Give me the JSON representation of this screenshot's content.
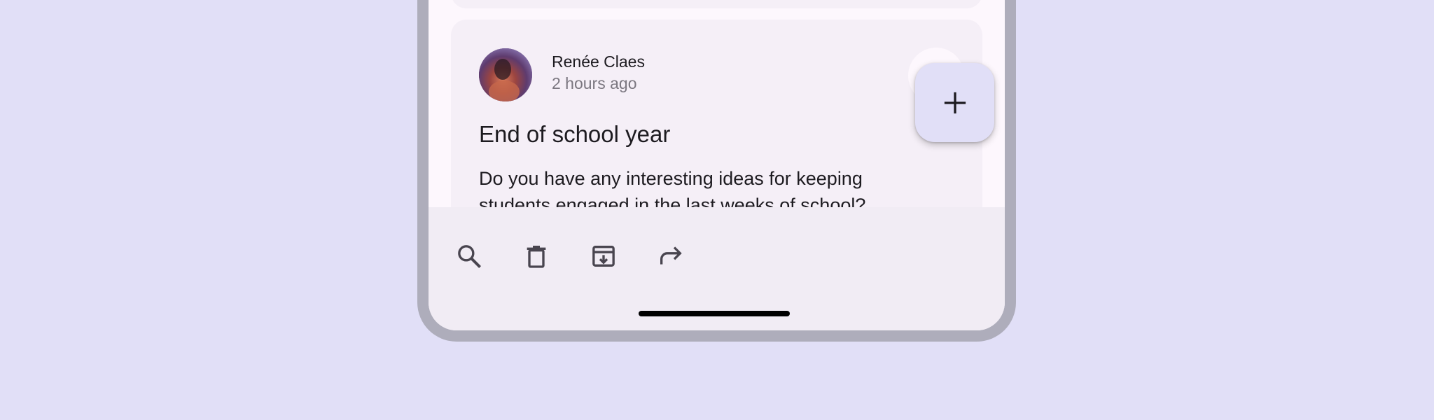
{
  "email": {
    "sender_name": "Renée Claes",
    "timestamp": "2 hours ago",
    "title": "End of school year",
    "body": "Do you have any interesting ideas for keeping students engaged in the last weeks of school?"
  },
  "icons": {
    "star": "star-outline-icon",
    "fab": "plus-icon",
    "search": "search-icon",
    "delete": "trash-icon",
    "archive": "archive-icon",
    "forward": "forward-icon"
  },
  "colors": {
    "background": "#e1dff7",
    "frame": "#aeadbb",
    "screen": "#fdf7fd",
    "card": "#f5eff7",
    "bottom_bar": "#f1ecf4",
    "fab": "#e1dff7",
    "icon": "#49454f"
  }
}
